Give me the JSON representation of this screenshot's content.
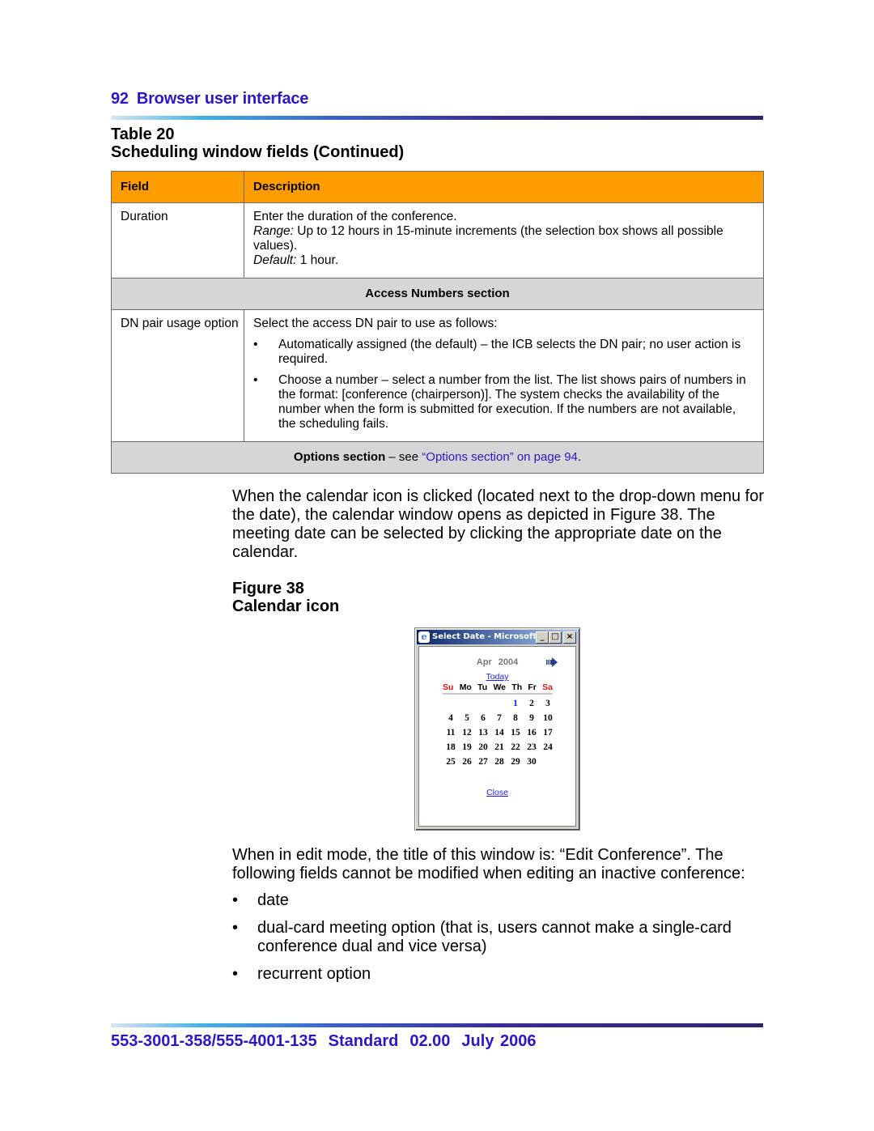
{
  "header": {
    "page_number": "92",
    "section_title": "Browser user interface"
  },
  "table": {
    "label": "Table 20",
    "title": "Scheduling window fields (Continued)",
    "columns": [
      "Field",
      "Description"
    ],
    "duration": {
      "field": "Duration",
      "line1": "Enter the duration of the conference.",
      "range_label": "Range:",
      "range_text": " Up to 12 hours in 15-minute increments (the selection box shows all possible values).",
      "default_label": "Default:",
      "default_text": " 1 hour."
    },
    "access_section": "Access Numbers section",
    "dn_pair": {
      "field": "DN pair usage option",
      "intro": "Select the access DN pair to use as follows:",
      "bullets": [
        "Automatically assigned (the default) – the ICB selects the DN pair; no user action is required.",
        "Choose a number – select a number from the list. The list shows pairs of numbers in the format: [conference (chairperson)]. The system checks the availability of the number when the form is submitted for execution. If the numbers are not available, the scheduling fails."
      ]
    },
    "options_section": {
      "bold": "Options section",
      "dash": " – see ",
      "link": "“Options section” on page 94",
      "end": "."
    }
  },
  "body": {
    "para1": "When the calendar icon is clicked (located next to the drop-down menu for the date), the calendar window opens as depicted in Figure 38. The meeting date can be selected by clicking the appropriate date on the calendar.",
    "figure_label": "Figure 38",
    "figure_title": "Calendar icon",
    "para2": "When in edit mode, the title of this window is: “Edit Conference”. The following fields cannot be modified when editing an inactive conference:",
    "list": [
      "date",
      "dual-card meeting option (that is, users cannot make a single-card conference dual and vice versa)",
      "recurrent option"
    ]
  },
  "calendar_window": {
    "title": "Select Date - Microsoft I...",
    "icon": "ie-icon",
    "month": "Apr",
    "year": "2004",
    "next_icon": "next-month-arrow-icon",
    "today_link": "Today",
    "weekdays": [
      "Su",
      "Mo",
      "Tu",
      "We",
      "Th",
      "Fr",
      "Sa"
    ],
    "first_weekday_index": 4,
    "days": [
      "1",
      "2",
      "3",
      "4",
      "5",
      "6",
      "7",
      "8",
      "9",
      "10",
      "11",
      "12",
      "13",
      "14",
      "15",
      "16",
      "17",
      "18",
      "19",
      "20",
      "21",
      "22",
      "23",
      "24",
      "25",
      "26",
      "27",
      "28",
      "29",
      "30"
    ],
    "highlighted_day": "1",
    "close_link": "Close",
    "colors": {
      "weekend": "#e01010",
      "link": "#1a1ae6",
      "title_bar": "#0a246a"
    }
  },
  "footer": {
    "doc_number": "553-3001-358/555-4001-135",
    "status": "Standard",
    "version": "02.00",
    "date": "July 2006"
  }
}
